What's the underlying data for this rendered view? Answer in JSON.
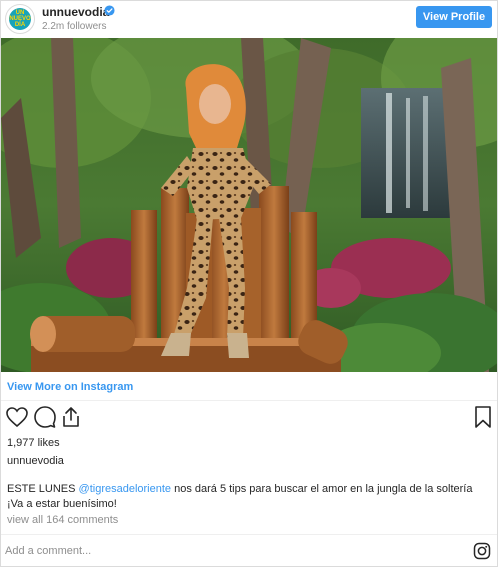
{
  "header": {
    "avatar_text": "UN NUEVO DÍA",
    "username": "unnuevodia",
    "followers": "2.2m followers",
    "view_profile_label": "View Profile",
    "verified_icon": "verified-badge-icon"
  },
  "post": {
    "image_alt": "Woman in leopard print outfit posing in a jungle set with wooden logs and tropical plants",
    "view_more_label": "View More on Instagram",
    "likes": "1,977 likes",
    "poster": "unnuevodia",
    "caption_start": "ESTE LUNES ",
    "caption_mention": "@tigresadeloriente",
    "caption_end": " nos dará 5 tips para buscar el amor en la jungla de la soltería ¡Va a estar buenísimo!",
    "comments_link": "view all 164 comments"
  },
  "actions": {
    "like_icon": "heart-icon",
    "comment_icon": "comment-icon",
    "share_icon": "share-icon",
    "save_icon": "bookmark-icon"
  },
  "footer": {
    "comment_placeholder": "Add a comment...",
    "instagram_icon": "instagram-icon"
  },
  "colors": {
    "accent": "#3897f0",
    "muted": "#8e8e8e",
    "text": "#262626"
  }
}
